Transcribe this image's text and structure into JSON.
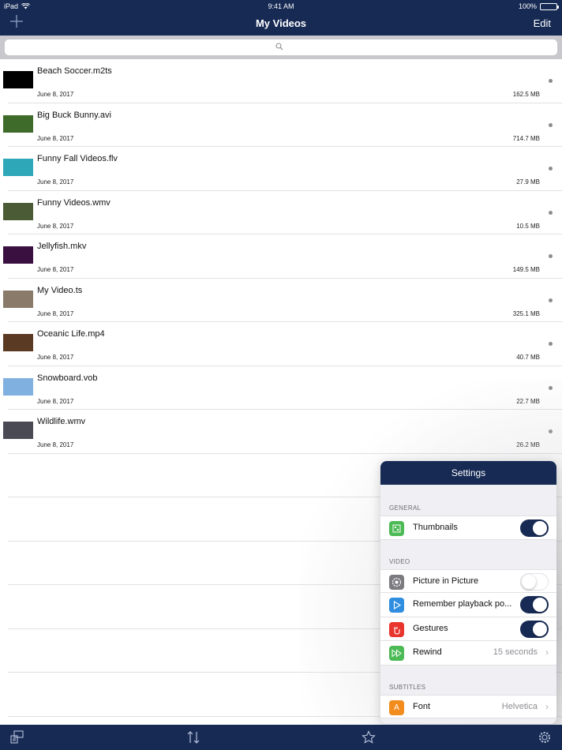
{
  "status": {
    "device": "iPad",
    "time": "9:41 AM",
    "battery": "100%"
  },
  "nav": {
    "title": "My Videos",
    "edit_label": "Edit",
    "add_icon": "plus-icon"
  },
  "search": {
    "placeholder": ""
  },
  "videos": [
    {
      "name": "Beach Soccer.m2ts",
      "date": "June 8, 2017",
      "size": "162.5 MB",
      "thumb_color": "#000000"
    },
    {
      "name": "Big Buck Bunny.avi",
      "date": "June 8, 2017",
      "size": "714.7 MB",
      "thumb_color": "#3f6b2a"
    },
    {
      "name": "Funny Fall Videos.flv",
      "date": "June 8, 2017",
      "size": "27.9 MB",
      "thumb_color": "#2ea7b8"
    },
    {
      "name": "Funny Videos.wmv",
      "date": "June 8, 2017",
      "size": "10.5 MB",
      "thumb_color": "#4b5b36"
    },
    {
      "name": "Jellyfish.mkv",
      "date": "June 8, 2017",
      "size": "149.5 MB",
      "thumb_color": "#3a1040"
    },
    {
      "name": "My Video.ts",
      "date": "June 8, 2017",
      "size": "325.1 MB",
      "thumb_color": "#8a7a6a"
    },
    {
      "name": "Oceanic Life.mp4",
      "date": "June 8, 2017",
      "size": "40.7 MB",
      "thumb_color": "#5a3a22"
    },
    {
      "name": "Snowboard.vob",
      "date": "June 8, 2017",
      "size": "22.7 MB",
      "thumb_color": "#7fb0e0"
    },
    {
      "name": "Wildlife.wmv",
      "date": "June 8, 2017",
      "size": "26.2 MB",
      "thumb_color": "#4a4a55"
    }
  ],
  "settings": {
    "title": "Settings",
    "general_label": "GENERAL",
    "video_label": "VIDEO",
    "subtitles_label": "SUBTITLES",
    "thumbnails": {
      "label": "Thumbnails",
      "on": true,
      "icon": "grid-icon",
      "icon_color": "#4cba55"
    },
    "pip": {
      "label": "Picture in Picture",
      "on": false,
      "icon": "gear-icon",
      "icon_color": "#7b7b80"
    },
    "remember": {
      "label": "Remember playback po...",
      "on": true,
      "icon": "play-icon",
      "icon_color": "#2f8ee0"
    },
    "gestures": {
      "label": "Gestures",
      "on": true,
      "icon": "hand-icon",
      "icon_color": "#e8352e"
    },
    "rewind": {
      "label": "Rewind",
      "value": "15 seconds",
      "icon": "rewind-icon",
      "icon_color": "#4cba55"
    },
    "font": {
      "label": "Font",
      "value": "Helvetica",
      "icon_glyph": "A",
      "icon_color": "#f28c1c"
    }
  },
  "toolbar": {
    "icons": [
      "connect-icon",
      "sort-icon",
      "star-icon",
      "gear-icon"
    ]
  }
}
